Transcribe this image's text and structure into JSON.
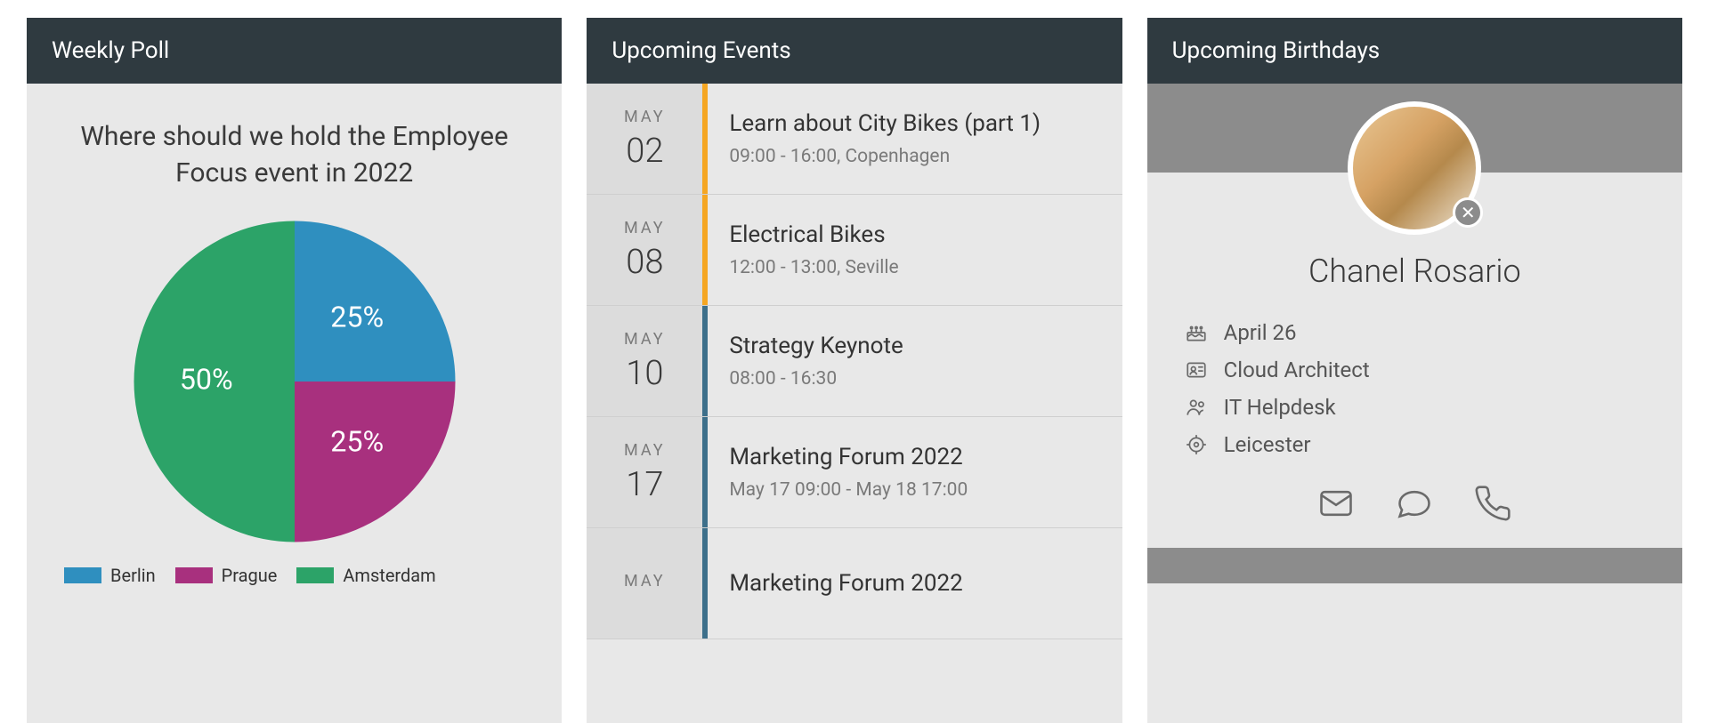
{
  "poll": {
    "header": "Weekly Poll",
    "question": "Where should we hold the Employee Focus event in 2022",
    "legend": [
      {
        "label": "Berlin",
        "color": "#2f8fbf"
      },
      {
        "label": "Prague",
        "color": "#a8307e"
      },
      {
        "label": "Amsterdam",
        "color": "#2ca368"
      }
    ]
  },
  "chart_data": {
    "type": "pie",
    "title": "Where should we hold the Employee Focus event in 2022",
    "series": [
      {
        "name": "Berlin",
        "value": 25,
        "color": "#2f8fbf",
        "label": "25%"
      },
      {
        "name": "Prague",
        "value": 25,
        "color": "#a8307e",
        "label": "25%"
      },
      {
        "name": "Amsterdam",
        "value": 50,
        "color": "#2ca368",
        "label": "50%"
      }
    ]
  },
  "events": {
    "header": "Upcoming Events",
    "items": [
      {
        "month": "MAY",
        "day": "02",
        "bar_color": "#f5a623",
        "title": "Learn about City Bikes (part 1)",
        "detail": "09:00 - 16:00, Copenhagen"
      },
      {
        "month": "MAY",
        "day": "08",
        "bar_color": "#f5a623",
        "title": "Electrical Bikes",
        "detail": "12:00 - 13:00, Seville"
      },
      {
        "month": "MAY",
        "day": "10",
        "bar_color": "#3d6f8a",
        "title": "Strategy Keynote",
        "detail": "08:00 - 16:30"
      },
      {
        "month": "MAY",
        "day": "17",
        "bar_color": "#3d6f8a",
        "title": "Marketing Forum 2022",
        "detail": "May 17 09:00 - May 18 17:00"
      },
      {
        "month": "MAY",
        "day": "",
        "bar_color": "#3d6f8a",
        "title": "Marketing Forum 2022",
        "detail": ""
      }
    ]
  },
  "birthdays": {
    "header": "Upcoming Birthdays",
    "person": {
      "name": "Chanel Rosario",
      "date": "April 26",
      "role": "Cloud Architect",
      "team": "IT Helpdesk",
      "location": "Leicester"
    }
  }
}
